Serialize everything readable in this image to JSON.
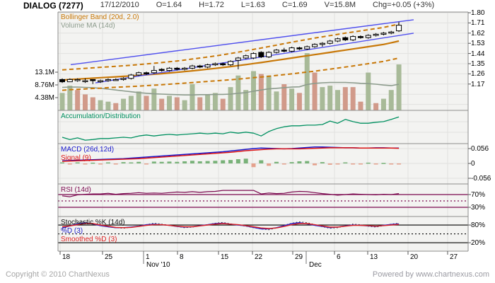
{
  "header": {
    "title": "DIALOG (7277)",
    "date": "17/12/2010",
    "open": "O=1.64",
    "high": "H=1.72",
    "low": "L=1.63",
    "close": "C=1.69",
    "volume": "V=15.8M",
    "change": "Chg=+0.05 (+3%)"
  },
  "footer": {
    "copyright": "Copyright © 2010 ChartNexus",
    "powered": "Powered by www.chartnexus.com"
  },
  "colors": {
    "panel_bg": "#f3f3f1",
    "grid": "#e2e2e0",
    "border": "#8c8c8c",
    "bollinger": "#c87808",
    "volume_ma": "#8d9c8d",
    "vol_up": "#a8ba98",
    "vol_down": "#d19a8a",
    "trend": "#5050ee",
    "ad_line": "#009060",
    "macd_line": "#1515cc",
    "signal_line": "#dd1515",
    "hist_pos": "#79b279",
    "hist_neg": "#e5a18d",
    "rsi_line": "#7c0a50",
    "stoch_k": "#222222",
    "stoch_d": "#2222cc",
    "stoch_sd": "#dd2222"
  },
  "chart_data": {
    "type": "candlestick+indicators",
    "symbol": "DIALOG (7277)",
    "last": {
      "open": 1.64,
      "high": 1.72,
      "low": 1.63,
      "close": 1.69,
      "volume_m": 15.8,
      "change": "+0.05 (+3%)"
    },
    "price_axis": {
      "labels": [
        1.8,
        1.71,
        1.62,
        1.53,
        1.44,
        1.35,
        1.26,
        1.17
      ],
      "ylim": [
        1.17,
        1.8
      ]
    },
    "volume_axis": {
      "labels": [
        "13.1M",
        "8.76M",
        "4.38M"
      ],
      "values": [
        13.14,
        8.76,
        4.38
      ]
    },
    "x_axis": {
      "ticks": [
        [
          "18",
          85
        ],
        [
          "25",
          145
        ],
        [
          "1",
          203
        ],
        [
          "8",
          251
        ],
        [
          "15",
          309
        ],
        [
          "22",
          357
        ],
        [
          "29",
          414
        ],
        [
          "6",
          473
        ],
        [
          "13",
          520
        ],
        [
          "20",
          577
        ],
        [
          "27",
          633
        ]
      ],
      "months": [
        [
          "Nov '10",
          205
        ],
        [
          "Dec",
          435
        ]
      ],
      "dividers": [
        203,
        433
      ]
    },
    "panels": {
      "main": {
        "legend_bb": "Bollinger Band (20d, 2.0)",
        "legend_volma": "Volume MA (14d)",
        "candles": [
          [
            1.21,
            1.22,
            1.18,
            1.19
          ],
          [
            1.19,
            1.22,
            1.19,
            1.21
          ],
          [
            1.2,
            1.22,
            1.19,
            1.21
          ],
          [
            1.2,
            1.22,
            1.18,
            1.2
          ],
          [
            1.21,
            1.21,
            1.17,
            1.2
          ],
          [
            1.19,
            1.21,
            1.18,
            1.2
          ],
          [
            1.2,
            1.22,
            1.19,
            1.21
          ],
          [
            1.21,
            1.22,
            1.2,
            1.21
          ],
          [
            1.21,
            1.23,
            1.2,
            1.22
          ],
          [
            1.22,
            1.26,
            1.21,
            1.25
          ],
          [
            1.25,
            1.28,
            1.24,
            1.27
          ],
          [
            1.27,
            1.28,
            1.25,
            1.26
          ],
          [
            1.27,
            1.33,
            1.26,
            1.29
          ],
          [
            1.3,
            1.31,
            1.28,
            1.29
          ],
          [
            1.29,
            1.32,
            1.28,
            1.31
          ],
          [
            1.31,
            1.32,
            1.29,
            1.3
          ],
          [
            1.3,
            1.32,
            1.29,
            1.31
          ],
          [
            1.31,
            1.34,
            1.3,
            1.33
          ],
          [
            1.33,
            1.34,
            1.31,
            1.32
          ],
          [
            1.32,
            1.35,
            1.31,
            1.34
          ],
          [
            1.34,
            1.36,
            1.33,
            1.35
          ],
          [
            1.35,
            1.36,
            1.33,
            1.34
          ],
          [
            1.34,
            1.38,
            1.33,
            1.37
          ],
          [
            1.38,
            1.41,
            1.3,
            1.4
          ],
          [
            1.4,
            1.43,
            1.39,
            1.42
          ],
          [
            1.4,
            1.45,
            1.39,
            1.44
          ],
          [
            1.45,
            1.46,
            1.4,
            1.41
          ],
          [
            1.41,
            1.46,
            1.4,
            1.45
          ],
          [
            1.45,
            1.48,
            1.44,
            1.47
          ],
          [
            1.47,
            1.49,
            1.45,
            1.46
          ],
          [
            1.46,
            1.5,
            1.45,
            1.49
          ],
          [
            1.49,
            1.5,
            1.47,
            1.48
          ],
          [
            1.48,
            1.51,
            1.47,
            1.5
          ],
          [
            1.5,
            1.53,
            1.49,
            1.52
          ],
          [
            1.52,
            1.54,
            1.5,
            1.53
          ],
          [
            1.53,
            1.56,
            1.52,
            1.55
          ],
          [
            1.55,
            1.58,
            1.54,
            1.57
          ],
          [
            1.58,
            1.59,
            1.55,
            1.56
          ],
          [
            1.56,
            1.6,
            1.55,
            1.59
          ],
          [
            1.59,
            1.6,
            1.57,
            1.58
          ],
          [
            1.58,
            1.61,
            1.57,
            1.6
          ],
          [
            1.6,
            1.62,
            1.59,
            1.61
          ],
          [
            1.61,
            1.63,
            1.6,
            1.62
          ],
          [
            1.62,
            1.64,
            1.61,
            1.63
          ],
          [
            1.64,
            1.72,
            1.63,
            1.69
          ]
        ],
        "volume": [
          [
            6.0,
            "u"
          ],
          [
            8.5,
            "u"
          ],
          [
            7.0,
            "d"
          ],
          [
            5.5,
            "d"
          ],
          [
            4.5,
            "d"
          ],
          [
            3.5,
            "u"
          ],
          [
            3.0,
            "u"
          ],
          [
            2.5,
            "d"
          ],
          [
            4.0,
            "u"
          ],
          [
            5.0,
            "u"
          ],
          [
            6.5,
            "u"
          ],
          [
            5.0,
            "d"
          ],
          [
            7.5,
            "u"
          ],
          [
            4.0,
            "d"
          ],
          [
            5.0,
            "u"
          ],
          [
            4.5,
            "d"
          ],
          [
            3.5,
            "u"
          ],
          [
            9.0,
            "u"
          ],
          [
            4.5,
            "d"
          ],
          [
            5.5,
            "u"
          ],
          [
            6.0,
            "u"
          ],
          [
            4.0,
            "d"
          ],
          [
            8.0,
            "u"
          ],
          [
            12.0,
            "u"
          ],
          [
            7.0,
            "u"
          ],
          [
            13.5,
            "u"
          ],
          [
            12.5,
            "d"
          ],
          [
            12.0,
            "u"
          ],
          [
            6.5,
            "u"
          ],
          [
            9.0,
            "d"
          ],
          [
            7.5,
            "u"
          ],
          [
            6.0,
            "d"
          ],
          [
            19.7,
            "u"
          ],
          [
            13.0,
            "d"
          ],
          [
            8.0,
            "u"
          ],
          [
            8.5,
            "u"
          ],
          [
            7.0,
            "u"
          ],
          [
            8.0,
            "d"
          ],
          [
            8.0,
            "d"
          ],
          [
            3.0,
            "d"
          ],
          [
            13.0,
            "u"
          ],
          [
            2.5,
            "d"
          ],
          [
            4.0,
            "u"
          ],
          [
            7.0,
            "u"
          ],
          [
            15.8,
            "u"
          ]
        ],
        "volume_ma": [
          7.9,
          8.0,
          8.0,
          7.9,
          7.8,
          7.6,
          7.3,
          7.0,
          6.7,
          6.4,
          6.1,
          5.9,
          5.7,
          5.6,
          5.5,
          5.4,
          5.3,
          5.3,
          5.4,
          5.4,
          5.5,
          5.5,
          5.6,
          5.9,
          6.1,
          6.6,
          7.0,
          7.4,
          7.6,
          7.8,
          8.0,
          8.1,
          8.9,
          9.3,
          9.5,
          9.6,
          9.6,
          9.6,
          9.5,
          9.3,
          9.2,
          9.0,
          8.7,
          8.5,
          9.0
        ],
        "bb_mid": [
          1.205,
          1.21,
          1.214,
          1.218,
          1.222,
          1.226,
          1.23,
          1.234,
          1.238,
          1.242,
          1.247,
          1.252,
          1.257,
          1.262,
          1.268,
          1.274,
          1.28,
          1.287,
          1.294,
          1.301,
          1.308,
          1.316,
          1.324,
          1.333,
          1.342,
          1.351,
          1.36,
          1.37,
          1.38,
          1.39,
          1.4,
          1.41,
          1.42,
          1.43,
          1.44,
          1.45,
          1.46,
          1.47,
          1.48,
          1.49,
          1.5,
          1.51,
          1.52,
          1.535,
          1.55
        ],
        "bb_spread": [
          0.09,
          0.09,
          0.09,
          0.091,
          0.091,
          0.092,
          0.092,
          0.093,
          0.093,
          0.094,
          0.095,
          0.096,
          0.097,
          0.098,
          0.099,
          0.1,
          0.102,
          0.104,
          0.106,
          0.108,
          0.11,
          0.113,
          0.116,
          0.119,
          0.122,
          0.125,
          0.128,
          0.131,
          0.134,
          0.137,
          0.14,
          0.142,
          0.144,
          0.146,
          0.147,
          0.148,
          0.149,
          0.15,
          0.15,
          0.15,
          0.15,
          0.15,
          0.15,
          0.15,
          0.15
        ],
        "trendlines": [
          {
            "i1": 1.11,
            "p1": 1.341,
            "i2": 45.93,
            "p2": 1.738
          },
          {
            "i1": 4.34,
            "p1": 1.181,
            "i2": 45.93,
            "p2": 1.619
          }
        ]
      },
      "ad": {
        "legend": "Accumulation/Distribution",
        "values": [
          20,
          13,
          18,
          11,
          13,
          16,
          16,
          18,
          20,
          18,
          24,
          27,
          24,
          27,
          29,
          27,
          29,
          31,
          33,
          31,
          33,
          31,
          36,
          33,
          36,
          33,
          24,
          38,
          47,
          53,
          56,
          56,
          58,
          58,
          60,
          71,
          64,
          76,
          69,
          64,
          64,
          67,
          69,
          76,
          84
        ],
        "ylim": [
          0,
          100
        ]
      },
      "macd": {
        "legend_macd": "MACD (26d,12d)",
        "legend_signal": "Signal (9)",
        "axis_labels": [
          "0.056",
          "0",
          "-0.056"
        ],
        "axis_values": [
          0.056,
          0,
          -0.056
        ],
        "macd": [
          0.01,
          0.011,
          0.012,
          0.013,
          0.014,
          0.015,
          0.016,
          0.017,
          0.018,
          0.02,
          0.022,
          0.024,
          0.026,
          0.028,
          0.03,
          0.032,
          0.034,
          0.036,
          0.038,
          0.04,
          0.042,
          0.044,
          0.047,
          0.05,
          0.053,
          0.056,
          0.058,
          0.057,
          0.056,
          0.055,
          0.056,
          0.058,
          0.06,
          0.062,
          0.062,
          0.061,
          0.06,
          0.059,
          0.059,
          0.058,
          0.058,
          0.059,
          0.059,
          0.058,
          0.058
        ],
        "signal": [
          0.008,
          0.009,
          0.01,
          0.011,
          0.012,
          0.013,
          0.014,
          0.015,
          0.016,
          0.017,
          0.018,
          0.02,
          0.022,
          0.024,
          0.026,
          0.028,
          0.03,
          0.032,
          0.034,
          0.036,
          0.038,
          0.04,
          0.042,
          0.045,
          0.048,
          0.05,
          0.052,
          0.054,
          0.055,
          0.055,
          0.055,
          0.055,
          0.056,
          0.057,
          0.058,
          0.059,
          0.059,
          0.059,
          0.059,
          0.058,
          0.058,
          0.058,
          0.058,
          0.058,
          0.057
        ],
        "hist": [
          0.004,
          -0.003,
          0.004,
          -0.003,
          0.003,
          -0.003,
          0.004,
          -0.003,
          0.005,
          0.004,
          0.006,
          -0.004,
          0.007,
          0.006,
          0.007,
          0.006,
          0.008,
          0.01,
          0.008,
          0.009,
          0.01,
          0.012,
          0.013,
          0.016,
          0.018,
          -0.014,
          0.012,
          -0.009,
          0.006,
          -0.004,
          0.005,
          0.008,
          0.009,
          -0.007,
          0.005,
          -0.005,
          -0.004,
          0.004,
          -0.003,
          -0.002,
          0.003,
          -0.002,
          0.002,
          -0.002,
          -0.003
        ]
      },
      "rsi": {
        "legend": "RSI (14d)",
        "axis_labels": [
          "70%",
          "30%"
        ],
        "levels": [
          70,
          30
        ],
        "dotted_level": 50,
        "values": [
          66,
          63,
          69,
          71,
          72,
          72,
          74,
          71,
          73,
          74,
          76,
          74,
          75,
          74,
          76,
          78,
          77,
          79,
          77,
          79,
          80,
          83,
          83,
          83,
          83,
          83,
          72,
          75,
          73,
          74,
          78,
          80,
          79,
          76,
          73,
          71,
          68,
          70,
          72,
          71,
          70,
          69,
          71,
          70,
          73
        ]
      },
      "stoch": {
        "legend_k": "Stochastic %K (14d)",
        "legend_d": "%D (3)",
        "legend_sd": "Smoothed %D (3)",
        "axis_labels": [
          "80%",
          "20%"
        ],
        "levels": [
          80,
          20
        ],
        "dotted_level": 50,
        "k": [
          65,
          78,
          88,
          90,
          83,
          78,
          74,
          71,
          69,
          73,
          76,
          81,
          86,
          83,
          79,
          75,
          71,
          73,
          77,
          81,
          86,
          89,
          84,
          80,
          76,
          71,
          67,
          64,
          70,
          79,
          86,
          91,
          88,
          81,
          74,
          69,
          71,
          77,
          83,
          81,
          76,
          73,
          78,
          83,
          86
        ],
        "d": [
          70,
          77,
          84,
          87,
          84,
          78,
          74,
          71,
          71,
          73,
          76,
          81,
          83,
          81,
          79,
          75,
          73,
          74,
          78,
          81,
          85,
          86,
          83,
          80,
          77,
          72,
          67,
          67,
          71,
          78,
          85,
          88,
          84,
          79,
          75,
          71,
          73,
          77,
          80,
          79,
          77,
          75,
          79,
          82,
          84
        ],
        "sd": [
          74,
          77,
          81,
          85,
          85,
          80,
          76,
          72,
          71,
          72,
          75,
          79,
          81,
          81,
          79,
          76,
          74,
          74,
          77,
          80,
          83,
          85,
          83,
          81,
          78,
          74,
          70,
          68,
          70,
          75,
          81,
          85,
          85,
          81,
          77,
          73,
          73,
          76,
          79,
          79,
          78,
          76,
          78,
          80,
          82
        ]
      }
    }
  }
}
